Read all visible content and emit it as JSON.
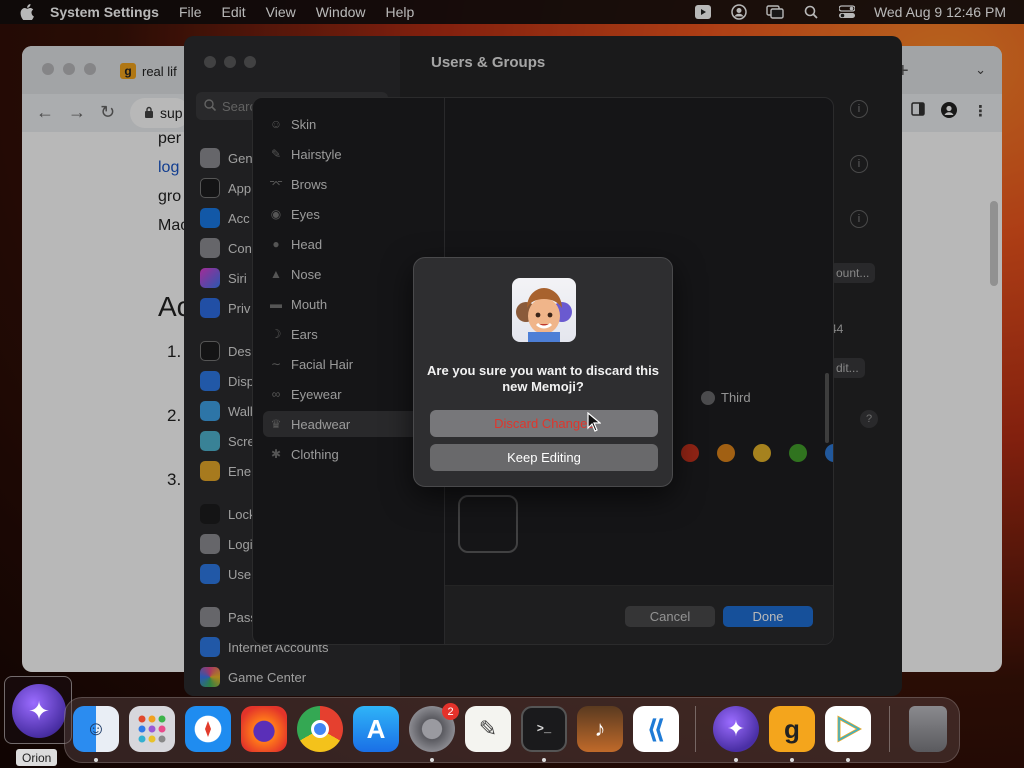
{
  "menubar": {
    "app_name": "System Settings",
    "menus": [
      "File",
      "Edit",
      "View",
      "Window",
      "Help"
    ],
    "datetime": "Wed Aug 9  12:46 PM"
  },
  "browser": {
    "tab_title": "real lif",
    "favicon_letter": "g",
    "address_text": "sup",
    "content_lines": [
      "per",
      "log",
      "gro",
      "Mac"
    ],
    "heading": "Ac",
    "numbers": [
      "1.",
      "2.",
      "3."
    ]
  },
  "settings": {
    "title": "Users & Groups",
    "search_placeholder": "Search",
    "sidebar": [
      "Gen",
      "App",
      "Acc",
      "Con",
      "Siri",
      "Priv",
      "Des",
      "Disp",
      "Wall",
      "Scre",
      "Ener",
      "Lock",
      "Logi",
      "Use",
      "Pass",
      "Internet Accounts",
      "Game Center"
    ],
    "right_labels": {
      "account_btn": "ount...",
      "edit_btn": "dit...",
      "stepper": "44"
    }
  },
  "editor": {
    "categories": [
      "Skin",
      "Hairstyle",
      "Brows",
      "Eyes",
      "Head",
      "Nose",
      "Mouth",
      "Ears",
      "Facial Hair",
      "Eyewear",
      "Headwear",
      "Clothing"
    ],
    "selected_category": "Headwear",
    "radio_label": "Third",
    "swatch_colors": [
      "#c8331e",
      "#e0861b",
      "#e7b52a",
      "#43a02c",
      "#2f7bd8"
    ],
    "cancel_label": "Cancel",
    "done_label": "Done"
  },
  "alert": {
    "message": "Are you sure you want to discard this new Memoji?",
    "discard_label": "Discard Changes",
    "keep_label": "Keep Editing"
  },
  "dock": {
    "orion_label": "Orion",
    "settings_badge": "2"
  }
}
